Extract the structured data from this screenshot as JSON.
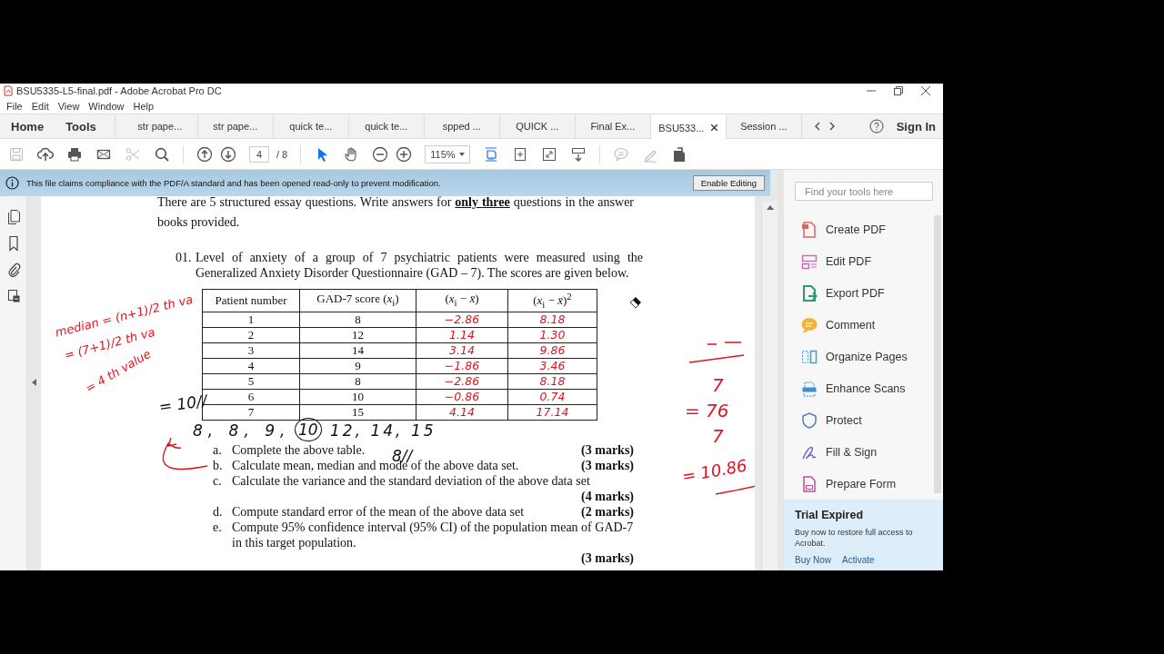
{
  "window": {
    "title": "BSU5335-L5-final.pdf - Adobe Acrobat Pro DC"
  },
  "menu": [
    "File",
    "Edit",
    "View",
    "Window",
    "Help"
  ],
  "nav_tabs": [
    "Home",
    "Tools"
  ],
  "document_tabs": [
    {
      "label": "str pape...",
      "selected": false
    },
    {
      "label": "str pape...",
      "selected": false
    },
    {
      "label": "quick te...",
      "selected": false
    },
    {
      "label": "quick te...",
      "selected": false
    },
    {
      "label": "spped ...",
      "selected": false
    },
    {
      "label": "QUICK ...",
      "selected": false
    },
    {
      "label": "Final Ex...",
      "selected": false
    },
    {
      "label": "BSU533...",
      "selected": true
    },
    {
      "label": "Session ...",
      "selected": false
    }
  ],
  "sign_in": "Sign In",
  "toolbar": {
    "file_tools": [
      {
        "kind": "save",
        "disabled": true
      },
      {
        "kind": "upload",
        "disabled": false
      },
      {
        "kind": "print",
        "disabled": false
      },
      {
        "kind": "email",
        "disabled": false
      },
      {
        "kind": "cut",
        "disabled": true
      },
      {
        "kind": "search",
        "disabled": false
      }
    ],
    "page_number": "4",
    "page_count": "/ 8",
    "cursor_tools": [
      {
        "kind": "select",
        "selected": true
      },
      {
        "kind": "hand",
        "selected": false
      }
    ],
    "zoom": "115%",
    "markup_tools": [
      {
        "kind": "comment",
        "disabled": true
      },
      {
        "kind": "highlight",
        "disabled": true
      },
      {
        "kind": "share",
        "disabled": false
      }
    ]
  },
  "banner": {
    "message": "This file claims compliance with the PDF/A standard and has been opened read-only to prevent modification.",
    "button": "Enable Editing"
  },
  "document": {
    "intro": "There are 5 structured essay questions. Write answers for **only three** questions in the answer books provided.",
    "question": {
      "number": "01.",
      "text": "Level of anxiety of a group of 7 psychiatric patients were measured using the Generalized Anxiety Disorder Questionnaire (GAD – 7). The scores are given below."
    },
    "table": {
      "columns": [
        {
          "label": "Patient number",
          "handwritten": false
        },
        {
          "label": "GAD-7 score  (*x*$_{i}$)",
          "handwritten": false
        },
        {
          "label": "(*x*$_{i}$ − *x̄*)",
          "handwritten": true
        },
        {
          "label": "(*x*$_{i}$ − *x̄*)$^{2}$",
          "handwritten": true
        }
      ],
      "rows": [
        [
          "1",
          "8",
          "−2.86",
          "8.18"
        ],
        [
          "2",
          "12",
          "1.14",
          "1.30"
        ],
        [
          "3",
          "14",
          "3.14",
          "9.86"
        ],
        [
          "4",
          "9",
          "−1.86",
          "3.46"
        ],
        [
          "5",
          "8",
          "−2.86",
          "8.18"
        ],
        [
          "6",
          "10",
          "−0.86",
          "0.74"
        ],
        [
          "7",
          "15",
          "4.14",
          "17.14"
        ]
      ]
    },
    "sub_questions": [
      {
        "letter": "a.",
        "text": "Complete the above table.",
        "marks": "(3 marks)"
      },
      {
        "letter": "b.",
        "text": "Calculate mean, median and mode of the above data set.",
        "marks": "(3 marks)"
      },
      {
        "letter": "c.",
        "text": "Calculate the variance and the standard deviation of the above data set",
        "marks": "(4 marks)"
      },
      {
        "letter": "d.",
        "text": "Compute standard error of the mean of the above data set",
        "marks": "(2 marks)"
      },
      {
        "letter": "e.",
        "text": "Compute 95% confidence interval (95% CI) of the population mean of GAD-7 in this target population.",
        "marks": "(3 marks)"
      }
    ],
    "annotations": [
      {
        "text": "median = (n+1)/2 th va",
        "color": "#e0141e"
      },
      {
        "text": "= (7+1)/2 th va",
        "color": "#e0141e"
      },
      {
        "text": "= 4 th value",
        "color": "#e0141e"
      },
      {
        "text": "= 10//",
        "color": "#111111"
      },
      {
        "text": "8, 8, 9,",
        "color": "#111111",
        "circled": false
      },
      {
        "text": "10",
        "color": "#111111",
        "circled": true
      },
      {
        "text": "12, 14, 15",
        "color": "#111111",
        "circled": false
      },
      {
        "text": "8//",
        "color": "#111111"
      },
      {
        "text": "7",
        "color": "#e0141e"
      },
      {
        "text": "= 76",
        "color": "#e0141e"
      },
      {
        "text": "7",
        "color": "#e0141e"
      },
      {
        "text": "= 10.86",
        "color": "#e0141e"
      }
    ]
  },
  "tools_panel": {
    "search_placeholder": "Find your tools here",
    "tools": [
      {
        "label": "Create PDF",
        "color": "#e0625a"
      },
      {
        "label": "Edit PDF",
        "color": "#d35fc5"
      },
      {
        "label": "Export PDF",
        "color": "#2f9a6a"
      },
      {
        "label": "Comment",
        "color": "#f0b43c"
      },
      {
        "label": "Organize Pages",
        "color": "#3aa3d6"
      },
      {
        "label": "Enhance Scans",
        "color": "#3a8fd6"
      },
      {
        "label": "Protect",
        "color": "#4a7fc0"
      },
      {
        "label": "Fill & Sign",
        "color": "#7b5fd6"
      },
      {
        "label": "Prepare Form",
        "color": "#c04f9a"
      }
    ],
    "trial": {
      "title": "Trial Expired",
      "text": "Buy now to restore full access to Acrobat.",
      "links": [
        "Buy Now",
        "Activate"
      ]
    }
  }
}
